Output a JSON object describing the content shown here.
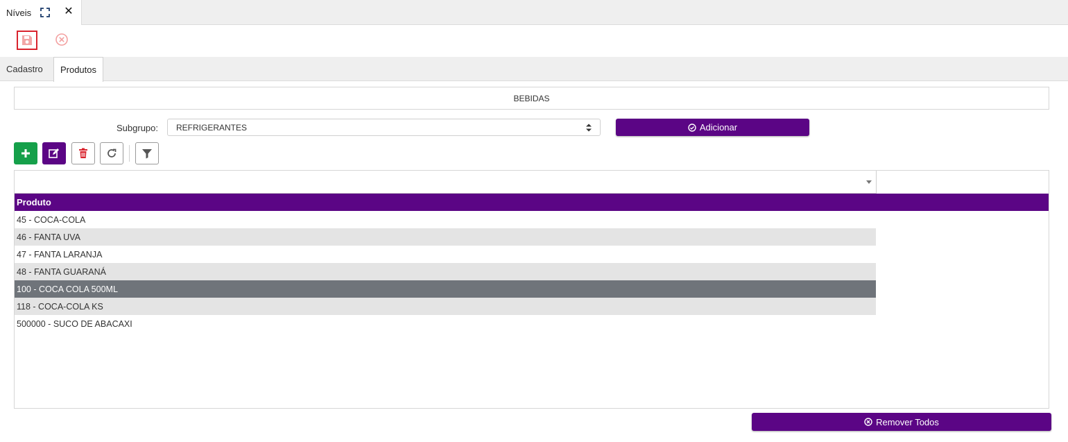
{
  "window_tab": {
    "title": "Níveis",
    "expand_icon": "expand-icon",
    "close_icon": "close-icon"
  },
  "toolbar": {
    "save_icon": "save-icon",
    "cancel_icon": "cancel-circle-icon",
    "save_color": "#d9232d"
  },
  "subtabs": [
    {
      "label": "Cadastro"
    },
    {
      "label": "Produtos",
      "active": true
    }
  ],
  "group": {
    "name": "BEBIDAS"
  },
  "subgrupo": {
    "label": "Subgrupo:",
    "selected": "REFRIGERANTES"
  },
  "buttons": {
    "adicionar": "Adicionar",
    "remover_todos": "Remover Todos"
  },
  "grid": {
    "header": "Produto",
    "rows": [
      {
        "text": "45 - COCA-COLA"
      },
      {
        "text": "46 - FANTA UVA"
      },
      {
        "text": "47 - FANTA LARANJA"
      },
      {
        "text": "48 - FANTA GUARANÁ"
      },
      {
        "text": "100 - COCA COLA 500ML",
        "selected": true
      },
      {
        "text": "118 - COCA-COLA KS"
      },
      {
        "text": "500000 - SUCO DE ABACAXI"
      }
    ]
  },
  "colors": {
    "brand": "#5b0585",
    "new": "#15a04a",
    "selected_row": "#6f747a"
  }
}
